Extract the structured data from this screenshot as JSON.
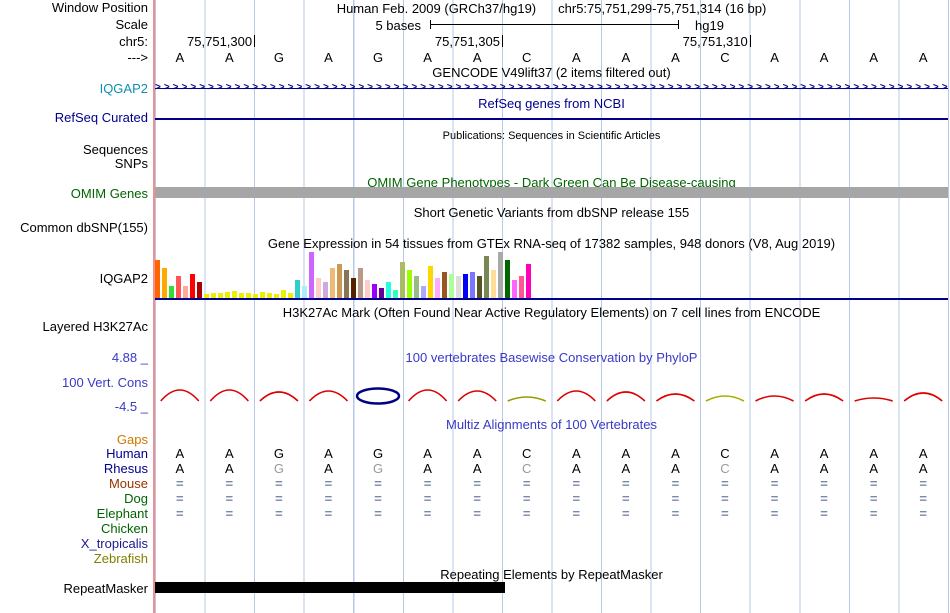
{
  "window": {
    "assembly": "Human Feb. 2009 (GRCh37/hg19)",
    "position": "chr5:75,751,299-75,751,314 (16 bp)"
  },
  "left_labels": {
    "window_position": "Window Position",
    "scale": "Scale",
    "chromosome": "chr5:",
    "strand_arrow": "--->",
    "gencode_gene": "IQGAP2",
    "refseq": "RefSeq Curated",
    "sequences": "Sequences",
    "snps": "SNPs",
    "omim": "OMIM Genes",
    "dbsnp": "Common dbSNP(155)",
    "gtex_gene": "IQGAP2",
    "h3k27ac": "Layered H3K27Ac",
    "cons_max": "4.88 _",
    "cons": "100 Vert. Cons",
    "cons_min": "-4.5 _",
    "repeatmasker": "RepeatMasker"
  },
  "scale": {
    "label": "5 bases",
    "assembly": "hg19"
  },
  "ruler": {
    "marks": [
      {
        "label": "75,751,300",
        "col": 2
      },
      {
        "label": "75,751,305",
        "col": 7
      },
      {
        "label": "75,751,310",
        "col": 12
      }
    ]
  },
  "sequence": {
    "bases": [
      "A",
      "A",
      "G",
      "A",
      "G",
      "A",
      "A",
      "C",
      "A",
      "A",
      "A",
      "C",
      "A",
      "A",
      "A",
      "A"
    ]
  },
  "headers": {
    "gencode": "GENCODE V49lift37 (2 items filtered out)",
    "refseq": "RefSeq genes from NCBI",
    "publications": "Publications: Sequences in Scientific Articles",
    "omim": "OMIM Gene Phenotypes - Dark Green Can Be Disease-causing",
    "dbsnp": "Short Genetic Variants from dbSNP release 155",
    "gtex": "Gene Expression in 54 tissues from GTEx RNA-seq of 17382 samples, 948 donors (V8, Aug 2019)",
    "h3k27ac": "H3K27Ac Mark (Often Found Near Active Regulatory Elements) on 7 cell lines from ENCODE",
    "conservation": "100 vertebrates Basewise Conservation by PhyloP",
    "multiz": "Multiz Alignments of 100 Vertebrates",
    "repeatmasker": "Repeating Elements by RepeatMasker"
  },
  "gencode_track": {
    "arrow_char": ">",
    "gene": "IQGAP2"
  },
  "multiz": {
    "equals_char": "=",
    "equals_color": "#7A89A8",
    "rows": [
      {
        "name": "Gaps",
        "label_color": "#CC7A00",
        "type": "empty"
      },
      {
        "name": "Human",
        "label_color": "#00008B",
        "type": "bases",
        "bases": [
          "A",
          "A",
          "G",
          "A",
          "G",
          "A",
          "A",
          "C",
          "A",
          "A",
          "A",
          "C",
          "A",
          "A",
          "A",
          "A"
        ],
        "gray": []
      },
      {
        "name": "Rhesus",
        "label_color": "#00008B",
        "type": "bases",
        "bases": [
          "A",
          "A",
          "G",
          "A",
          "G",
          "A",
          "A",
          "C",
          "A",
          "A",
          "A",
          "C",
          "A",
          "A",
          "A",
          "A"
        ],
        "gray": [
          2,
          4,
          7,
          11
        ]
      },
      {
        "name": "Mouse",
        "label_color": "#993300",
        "type": "equals"
      },
      {
        "name": "Dog",
        "label_color": "#006400",
        "type": "equals"
      },
      {
        "name": "Elephant",
        "label_color": "#006400",
        "type": "equals"
      },
      {
        "name": "Chicken",
        "label_color": "#006400",
        "type": "empty"
      },
      {
        "name": "X_tropicalis",
        "label_color": "#1A1A8C",
        "type": "empty"
      },
      {
        "name": "Zebrafish",
        "label_color": "#808000",
        "type": "empty"
      }
    ]
  },
  "colors": {
    "track_navy": "#00008B",
    "gencode_label_teal": "#0E8FB0",
    "omim_green": "#006400",
    "omim_bar_gray": "#A6A6A6",
    "conservation_blue": "#3939C6",
    "phylop_red": "#DD0000",
    "guideline_blue": "#B7C9E6",
    "left_boundary_pink": "#F08F8F",
    "repeat_black": "#000000"
  },
  "chart_data": [
    {
      "id": "gtex-expression",
      "type": "bar",
      "title": "Gene Expression in 54 tissues from GTEx RNA-seq of 17382 samples, 948 donors (V8, Aug 2019)",
      "gene": "IQGAP2",
      "n_bars": 54,
      "value_units": "px (estimated bar heights, no numeric axis shown)",
      "bars": [
        {
          "value": 38,
          "color": "#FF6600"
        },
        {
          "value": 30,
          "color": "#FFAA00"
        },
        {
          "value": 12,
          "color": "#33DD33"
        },
        {
          "value": 22,
          "color": "#FF5555"
        },
        {
          "value": 12,
          "color": "#FFAA99"
        },
        {
          "value": 24,
          "color": "#FF0000"
        },
        {
          "value": 16,
          "color": "#AA0000"
        },
        {
          "value": 4,
          "color": "#EEEE00"
        },
        {
          "value": 5,
          "color": "#EEEE00"
        },
        {
          "value": 5,
          "color": "#EEEE00"
        },
        {
          "value": 6,
          "color": "#EEEE00"
        },
        {
          "value": 7,
          "color": "#EEEE00"
        },
        {
          "value": 5,
          "color": "#EEEE00"
        },
        {
          "value": 5,
          "color": "#EEEE00"
        },
        {
          "value": 4,
          "color": "#EEEE00"
        },
        {
          "value": 6,
          "color": "#EEEE00"
        },
        {
          "value": 5,
          "color": "#EEEE00"
        },
        {
          "value": 4,
          "color": "#EEEE00"
        },
        {
          "value": 8,
          "color": "#EEEE00"
        },
        {
          "value": 5,
          "color": "#EEEE00"
        },
        {
          "value": 18,
          "color": "#33CCCC"
        },
        {
          "value": 12,
          "color": "#AAEEFF"
        },
        {
          "value": 46,
          "color": "#CC66FF"
        },
        {
          "value": 20,
          "color": "#FFCCCC"
        },
        {
          "value": 16,
          "color": "#CCAADD"
        },
        {
          "value": 30,
          "color": "#EEBB77"
        },
        {
          "value": 34,
          "color": "#CC9955"
        },
        {
          "value": 28,
          "color": "#8B7355"
        },
        {
          "value": 20,
          "color": "#552200"
        },
        {
          "value": 30,
          "color": "#BB9988"
        },
        {
          "value": 18,
          "color": "#FFCCCC"
        },
        {
          "value": 14,
          "color": "#9900FF"
        },
        {
          "value": 10,
          "color": "#660099"
        },
        {
          "value": 16,
          "color": "#22FFDD"
        },
        {
          "value": 8,
          "color": "#33FFC2"
        },
        {
          "value": 36,
          "color": "#AABB66"
        },
        {
          "value": 28,
          "color": "#99FF00"
        },
        {
          "value": 22,
          "color": "#99BB88"
        },
        {
          "value": 12,
          "color": "#AAAAFF"
        },
        {
          "value": 32,
          "color": "#FFD700"
        },
        {
          "value": 20,
          "color": "#FFAAFF"
        },
        {
          "value": 26,
          "color": "#995522"
        },
        {
          "value": 24,
          "color": "#AAFF99"
        },
        {
          "value": 22,
          "color": "#DDDDDD"
        },
        {
          "value": 24,
          "color": "#0000FF"
        },
        {
          "value": 26,
          "color": "#7777FF"
        },
        {
          "value": 22,
          "color": "#555522"
        },
        {
          "value": 42,
          "color": "#778855"
        },
        {
          "value": 28,
          "color": "#FFDD99"
        },
        {
          "value": 46,
          "color": "#AAAAAA"
        },
        {
          "value": 38,
          "color": "#006600"
        },
        {
          "value": 18,
          "color": "#FF66FF"
        },
        {
          "value": 22,
          "color": "#FF5599"
        },
        {
          "value": 34,
          "color": "#FF00BB"
        }
      ]
    },
    {
      "id": "phylop-conservation",
      "type": "area",
      "title": "100 vertebrates Basewise Conservation by PhyloP",
      "ylim": [
        -4.5,
        4.88
      ],
      "glyphs": [
        {
          "base": "A",
          "shape": "arc",
          "height": 11,
          "color": "#DD0000"
        },
        {
          "base": "A",
          "shape": "arc",
          "height": 11,
          "color": "#DD0000"
        },
        {
          "base": "G",
          "shape": "arc",
          "height": 9,
          "color": "#DD0000"
        },
        {
          "base": "A",
          "shape": "arc",
          "height": 10,
          "color": "#DD0000"
        },
        {
          "base": "G",
          "shape": "ellipse",
          "height": 16,
          "color": "#000080"
        },
        {
          "base": "A",
          "shape": "arc",
          "height": 11,
          "color": "#DD0000"
        },
        {
          "base": "A",
          "shape": "arc",
          "height": 10,
          "color": "#DD0000"
        },
        {
          "base": "C",
          "shape": "arc",
          "height": 4,
          "color": "#999900"
        },
        {
          "base": "A",
          "shape": "arc",
          "height": 10,
          "color": "#DD0000"
        },
        {
          "base": "A",
          "shape": "arc",
          "height": 9,
          "color": "#DD0000"
        },
        {
          "base": "A",
          "shape": "arc",
          "height": 7,
          "color": "#DD0000"
        },
        {
          "base": "C",
          "shape": "arc",
          "height": 5,
          "color": "#AAAA00"
        },
        {
          "base": "A",
          "shape": "arc",
          "height": 5,
          "color": "#DD0000"
        },
        {
          "base": "A",
          "shape": "arc",
          "height": 7,
          "color": "#DD0000"
        },
        {
          "base": "A",
          "shape": "arc",
          "height": 3,
          "color": "#DD0000"
        },
        {
          "base": "A",
          "shape": "arc",
          "height": 8,
          "color": "#DD0000"
        }
      ]
    }
  ]
}
